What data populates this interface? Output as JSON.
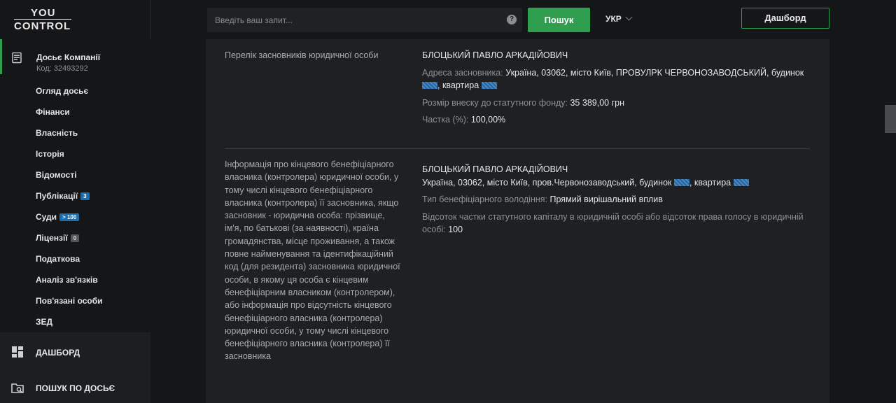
{
  "header": {
    "logo_line1": "YOU",
    "logo_line2": "CONTROL",
    "search_placeholder": "Введіть ваш запит...",
    "help_icon": "?",
    "search_button": "Пошук",
    "language": "УКР",
    "dashboard_button": "Дашборд"
  },
  "sidebar": {
    "dossier_title": "Досьє Компанії",
    "dossier_code": "Код: 32493292",
    "items": [
      {
        "label": "Огляд досьє"
      },
      {
        "label": "Фінанси"
      },
      {
        "label": "Власність"
      },
      {
        "label": "Історія"
      },
      {
        "label": "Відомості"
      },
      {
        "label": "Публікації",
        "badge": "3"
      },
      {
        "label": "Суди",
        "badge": "> 100"
      },
      {
        "label": "Ліцензії",
        "badge": "0"
      },
      {
        "label": "Податкова"
      },
      {
        "label": "Аналіз зв'язків"
      },
      {
        "label": "Пов'язані особи"
      },
      {
        "label": "ЗЕД"
      }
    ],
    "bottom": {
      "dashboard": "ДАШБОРД",
      "search_dossier": "ПОШУК ПО ДОСЬЄ"
    }
  },
  "main": {
    "founders": {
      "label": "Перелік засновників юридичної особи",
      "name": "БЛОЦЬКИЙ ПАВЛО АРКАДІЙОВИЧ",
      "address_label": "Адреса засновника:",
      "address_value": "Україна, 03062, місто Київ, ПРОВУЛРК ЧЕРВОНОЗАВОДСЬКИЙ, будинок",
      "address_suffix": ", квартира",
      "contribution_label": "Розмір внеску до статутного фонду:",
      "contribution_value": "35 389,00 грн",
      "share_label": "Частка (%):",
      "share_value": "100,00%"
    },
    "beneficiary": {
      "label": "Інформація про кінцевого бенефіціарного власника (контролера) юридичної особи, у тому числі кінцевого бенефіціарного власника (контролера) її засновника, якщо засновник - юридична особа: прізвище, ім'я, по батькові (за наявності), країна громадянства, місце проживання, а також повне найменування та ідентифікаційний код (для резидента) засновника юридичної особи, в якому ця особа є кінцевим бенефіціарним власником (контролером), або інформація про відсутність кінцевого бенефіціарного власника (контролера) юридичної особи, у тому числі кінцевого бенефіціарного власника (контролера) її засновника",
      "name": "БЛОЦЬКИЙ ПАВЛО АРКАДІЙОВИЧ",
      "address_value": "Україна, 03062, місто Київ, пров.Червонозаводський, будинок",
      "address_suffix": ", квартира",
      "ownership_label": "Тип бенефіціарного володіння:",
      "ownership_value": "Прямий вирішальний вплив",
      "percent_label": "Відсоток частки статутного капіталу в юридичній особі або відсоток права голосу в юридичній особі:",
      "percent_value": "100"
    }
  },
  "colors": {
    "accent": "#2f9e4f",
    "background": "#151618",
    "panel": "#1f2023",
    "badge_blue": "#1b6fb0"
  }
}
